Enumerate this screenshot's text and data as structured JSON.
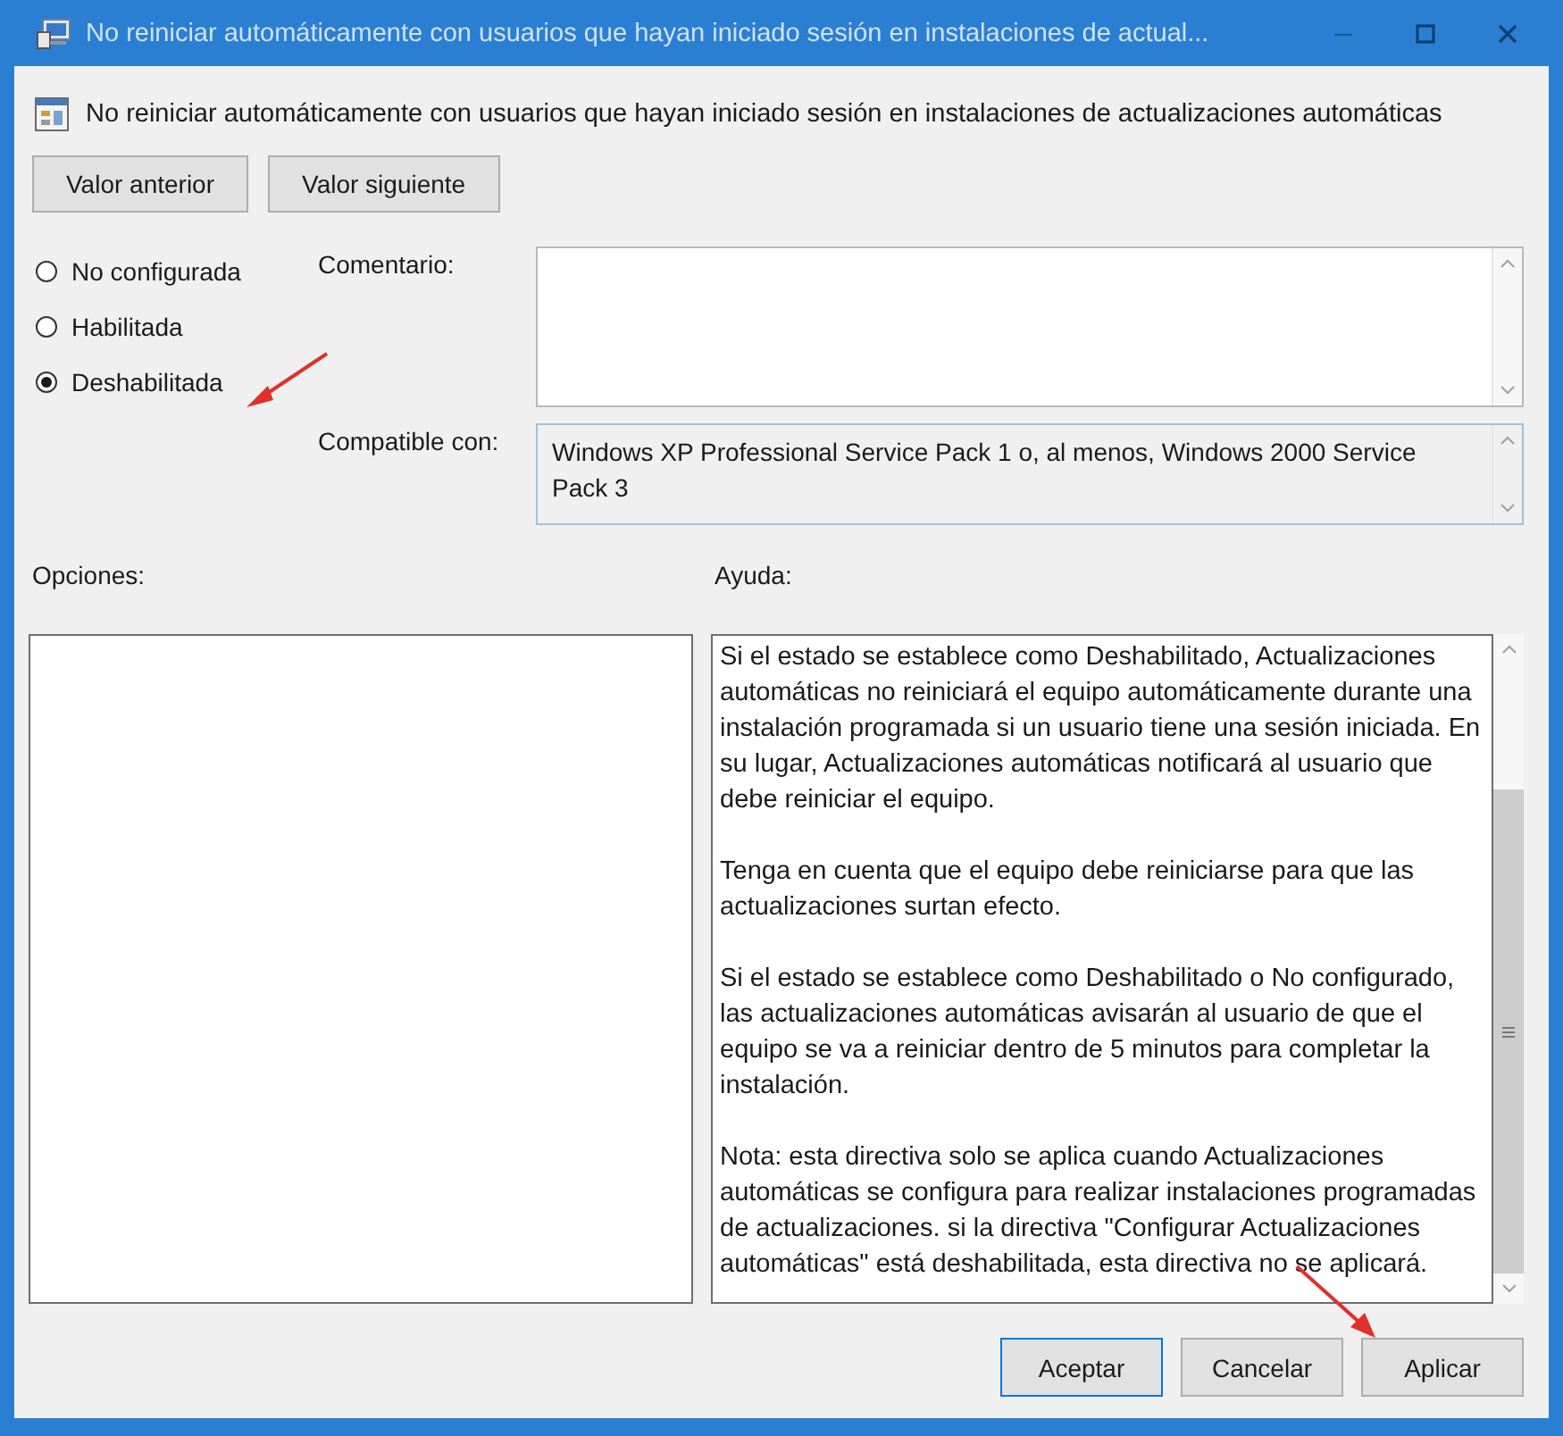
{
  "window": {
    "title": "No reiniciar automáticamente con usuarios que hayan iniciado sesión en instalaciones de actual..."
  },
  "policy_name": "No reiniciar automáticamente con usuarios que hayan iniciado sesión en instalaciones de actualizaciones automáticas",
  "nav_buttons": [
    "Valor anterior",
    "Valor siguiente"
  ],
  "states": [
    {
      "label": "No configurada",
      "selected": false
    },
    {
      "label": "Habilitada",
      "selected": false
    },
    {
      "label": "Deshabilitada",
      "selected": true
    }
  ],
  "comment": {
    "label": "Comentario:"
  },
  "compatible": {
    "label": "Compatible con:",
    "value": "Windows XP Professional Service Pack 1 o, al menos, Windows 2000 Service Pack 3"
  },
  "options": {
    "label": "Opciones:"
  },
  "help": {
    "label": "Ayuda:",
    "paragraphs": [
      "Si el estado se establece como Deshabilitado, Actualizaciones automáticas no reiniciará el equipo automáticamente durante una instalación programada si un usuario tiene una sesión iniciada. En su lugar, Actualizaciones automáticas notificará al usuario que debe reiniciar el equipo.",
      "Tenga en cuenta que el equipo debe reiniciarse para que las actualizaciones surtan efecto.",
      "Si el estado se establece como Deshabilitado o No configurado, las actualizaciones automáticas avisarán al usuario de que el equipo se va a reiniciar dentro de 5 minutos para completar la instalación.",
      "Nota: esta directiva solo se aplica cuando Actualizaciones automáticas se configura para realizar instalaciones programadas de actualizaciones. si la directiva \"Configurar Actualizaciones automáticas\" está deshabilitada, esta directiva no se aplicará."
    ]
  },
  "buttons": [
    {
      "label": "Aceptar",
      "selected": true
    },
    {
      "label": "Cancelar",
      "selected": false
    },
    {
      "label": "Aplicar",
      "selected": false
    }
  ]
}
